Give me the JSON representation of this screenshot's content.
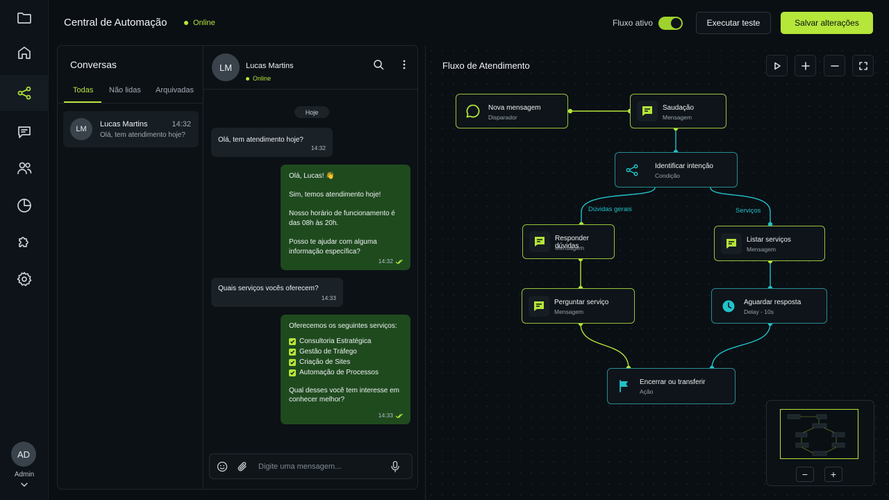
{
  "sidebar": {
    "items": [
      "folder-icon",
      "home-icon",
      "flow-icon",
      "chat-icon",
      "users-icon",
      "chart-icon",
      "puzzle-icon",
      "settings-icon"
    ],
    "active_item": "flow-icon",
    "user": {
      "initials": "AD",
      "label": "Admin"
    }
  },
  "header": {
    "title": "Central de Automação",
    "status": "Online",
    "flow_label": "Fluxo ativo",
    "flow_active": true,
    "test_button": "Executar teste",
    "save_button": "Salvar alterações"
  },
  "colors": {
    "accent": "#b5e63a",
    "teal": "#21c2c9",
    "bubble_out": "#1f4a1e",
    "background": "#0a0f14"
  },
  "conversations": {
    "title": "Conversas",
    "tabs": [
      "Todas",
      "Não lidas",
      "Arquivadas"
    ],
    "active_tab": "Todas",
    "items": [
      {
        "initials": "LM",
        "name": "Lucas Martins",
        "time": "14:32",
        "preview": "Olá, tem atendimento hoje?"
      }
    ]
  },
  "chat": {
    "contact": {
      "initials": "LM",
      "name": "Lucas Martins",
      "status": "Online"
    },
    "day_label": "Hoje",
    "messages": [
      {
        "dir": "in",
        "text": "Olá, tem atendimento hoje?",
        "time": "14:32"
      },
      {
        "dir": "out",
        "text": "Olá, Lucas! 👋\n\nSim, temos atendimento hoje!\n\nNosso horário de funcionamento é das 08h às 20h.\n\nPosso te ajudar com alguma informação específica?",
        "time": "14:32"
      },
      {
        "dir": "in",
        "text": "Quais serviços vocês oferecem?",
        "time": "14:33"
      },
      {
        "dir": "out",
        "intro": "Oferecemos os seguintes serviços:",
        "list": [
          "Consultoria Estratégica",
          "Gestão de Tráfego",
          "Criação de Sites",
          "Automação de Processos"
        ],
        "outro": "Qual desses você tem interesse em conhecer melhor?",
        "time": "14:33"
      }
    ],
    "input_placeholder": "Digite uma mensagem..."
  },
  "flow": {
    "title": "Fluxo de Atendimento",
    "controls": [
      "play-icon",
      "zoom-in-icon",
      "zoom-out-icon",
      "fullscreen-icon"
    ],
    "nodes": [
      {
        "id": "nova",
        "title": "Nova mensagem",
        "subtitle": "Disparador",
        "icon": "chat-bubble-icon"
      },
      {
        "id": "saudacao",
        "title": "Saudação",
        "subtitle": "Mensagem",
        "icon": "message-icon"
      },
      {
        "id": "intencao",
        "title": "Identificar intenção",
        "subtitle": "Condição",
        "icon": "share-icon"
      },
      {
        "id": "duvidas",
        "title": "Responder dúvidas",
        "subtitle": "Mensagem",
        "icon": "message-icon"
      },
      {
        "id": "listar",
        "title": "Listar serviços",
        "subtitle": "Mensagem",
        "icon": "message-icon"
      },
      {
        "id": "perguntar",
        "title": "Perguntar serviço",
        "subtitle": "Mensagem",
        "icon": "message-icon"
      },
      {
        "id": "aguardar",
        "title": "Aguardar resposta",
        "subtitle": "Delay - 10s",
        "icon": "clock-icon"
      },
      {
        "id": "encerrar",
        "title": "Encerrar ou transferir",
        "subtitle": "Ação",
        "icon": "flag-icon"
      }
    ],
    "edge_labels": [
      "Dúvidas gerais",
      "Serviços"
    ],
    "minimap": {
      "zoom_out": "−",
      "zoom_in": "+"
    }
  }
}
